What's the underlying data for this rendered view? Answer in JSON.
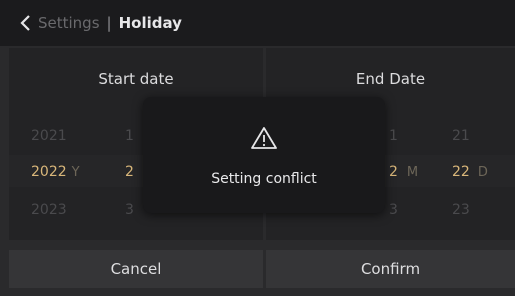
{
  "header": {
    "back_icon": "chevron-left-icon",
    "parent": "Settings",
    "separator": "|",
    "title": "Holiday"
  },
  "start_panel": {
    "title": "Start date",
    "year_above": "2021",
    "year_selected": "2022",
    "year_unit": "Y",
    "year_below": "2023",
    "month_above": "1",
    "month_selected": "2",
    "month_below": "3"
  },
  "end_panel": {
    "title": "End Date",
    "month_above": "1",
    "month_selected": "2",
    "month_unit": "M",
    "month_below": "3",
    "day_above": "21",
    "day_selected": "22",
    "day_unit": "D",
    "day_below": "23"
  },
  "buttons": {
    "cancel": "Cancel",
    "confirm": "Confirm"
  },
  "modal": {
    "icon": "warning-icon",
    "message": "Setting conflict"
  },
  "colors": {
    "selected": "#d9b77a",
    "background": "#2a2a2c",
    "header": "#1b1b1d"
  }
}
